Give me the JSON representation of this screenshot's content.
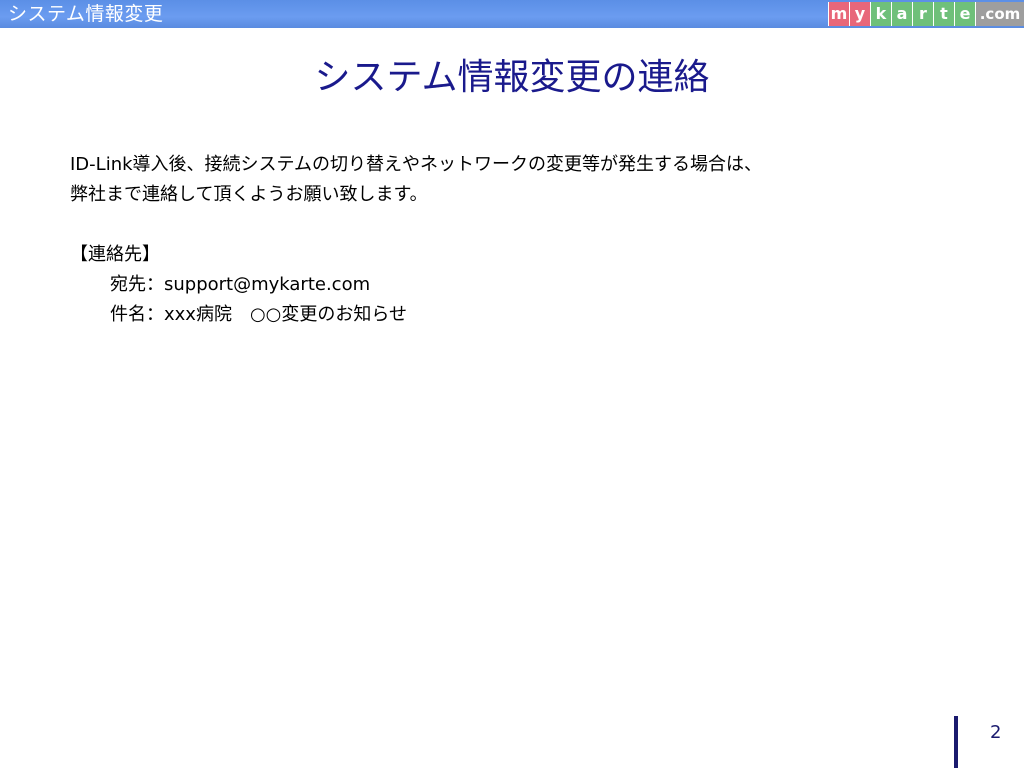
{
  "header": {
    "title": "システム情報変更",
    "logo": {
      "letters": [
        {
          "char": "m",
          "color": "#e8677a"
        },
        {
          "char": "y",
          "color": "#e8677a"
        },
        {
          "char": "k",
          "color": "#6fc07a"
        },
        {
          "char": "a",
          "color": "#6fc07a"
        },
        {
          "char": "r",
          "color": "#6fc07a"
        },
        {
          "char": "t",
          "color": "#6fc07a"
        },
        {
          "char": "e",
          "color": "#6fc07a"
        }
      ],
      "suffix": ".com",
      "suffix_color": "#9e9e9e"
    }
  },
  "slide": {
    "title": "システム情報変更の連絡",
    "paragraph_line1": "ID-Link導入後、接続システムの切り替えやネットワークの変更等が発生する場合は、",
    "paragraph_line2": "弊社まで連絡して頂くようお願い致します。",
    "contact_heading": "【連絡先】",
    "contact_to": "宛先：support@mykarte.com",
    "contact_subject": "件名：xxx病院　○○変更のお知らせ"
  },
  "footer": {
    "page_number": "2"
  },
  "colors": {
    "header_bar": "#6b9cf0",
    "title_text": "#1a1a8c",
    "page_bar": "#1a1a6e"
  }
}
